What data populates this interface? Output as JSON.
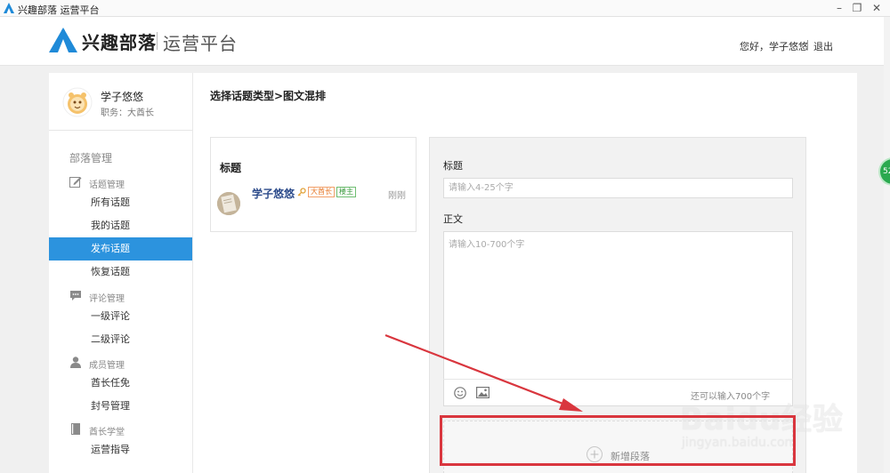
{
  "window": {
    "title": "兴趣部落 运营平台",
    "icons": [
      "app-icon",
      "minimize-icon",
      "restore-icon",
      "close-icon"
    ]
  },
  "header": {
    "logo_text": "兴趣部落",
    "logo_subtitle": "运营平台",
    "greeting": "您好，学子悠悠",
    "logout": "退出"
  },
  "sidebar": {
    "user_name": "学子悠悠",
    "user_role": "职务：大酋长",
    "section_title": "部落管理",
    "groups": [
      {
        "label": "话题管理",
        "icon": "edit-icon",
        "items": [
          "所有话题",
          "我的话题",
          "发布话题",
          "恢复话题"
        ]
      },
      {
        "label": "评论管理",
        "icon": "comment-icon",
        "items": [
          "一级评论",
          "二级评论"
        ]
      },
      {
        "label": "成员管理",
        "icon": "user-icon",
        "items": [
          "酋长任免",
          "封号管理"
        ]
      },
      {
        "label": "酋长学堂",
        "icon": "book-icon",
        "items": [
          "运营指导"
        ]
      }
    ],
    "active_item": "发布话题",
    "active_color": "#2c93de"
  },
  "main": {
    "breadcrumb": "选择话题类型>图文混排",
    "preview": {
      "title": "标题",
      "author": "学子悠悠",
      "badge_chief": "大酋长",
      "badge_owner": "楼主",
      "time": "刚刚"
    },
    "form": {
      "title_label": "标题",
      "title_placeholder": "请输入4-25个字",
      "body_label": "正文",
      "body_placeholder": "请输入10-700个字",
      "char_count": "还可以输入700个字",
      "add_paragraph": "新增段落"
    }
  },
  "float_badge": "52",
  "watermark": {
    "brand": "Baidu经验",
    "url": "jingyan.baidu.com"
  },
  "annotation_color": "#d9363e"
}
